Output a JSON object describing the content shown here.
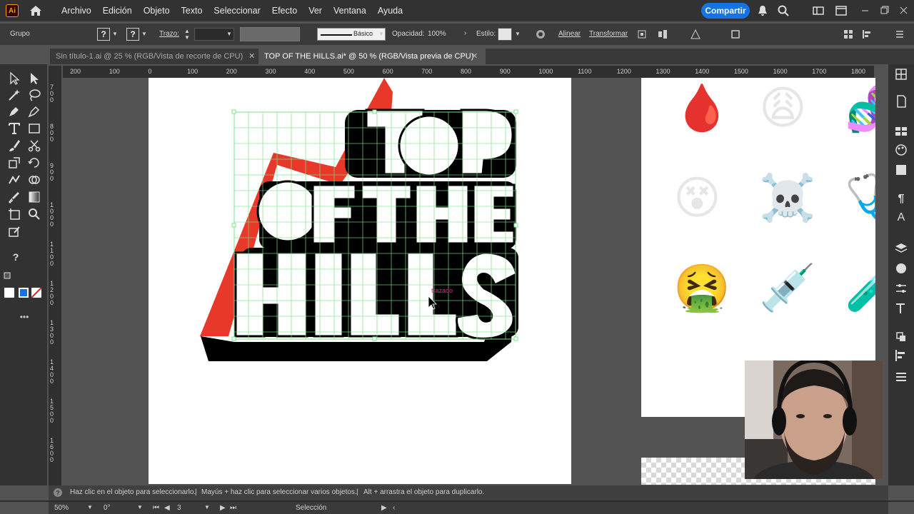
{
  "app": {
    "logo": "Ai"
  },
  "menu": [
    "Archivo",
    "Edición",
    "Objeto",
    "Texto",
    "Seleccionar",
    "Efecto",
    "Ver",
    "Ventana",
    "Ayuda"
  ],
  "share_label": "Compartir",
  "control_bar": {
    "selection_label": "Grupo",
    "stroke_label": "Trazo:",
    "stroke_profile": "Básico",
    "opacity_label": "Opacidad:",
    "opacity_value": "100%",
    "style_label": "Estilo:",
    "align_label": "Alinear",
    "transform_label": "Transformar"
  },
  "tabs": [
    {
      "label": "Sin título-1.ai @ 25 % (RGB/Vista de recorte de CPU)",
      "active": false
    },
    {
      "label": "TOP OF THE HILLS.ai* @ 50 % (RGB/Vista previa de CPU)",
      "active": true
    }
  ],
  "ruler": {
    "h_ticks": [
      "200",
      "100",
      "0",
      "100",
      "200",
      "300",
      "400",
      "500",
      "600",
      "700",
      "800",
      "900",
      "1000",
      "1100",
      "1200",
      "1300",
      "1400",
      "1500",
      "1600",
      "1700",
      "1800"
    ],
    "v_ticks": [
      "7\n0\n0",
      "8\n0\n0",
      "9\n0\n0",
      "1\n0\n0\n0",
      "1\n1\n0\n0",
      "1\n2\n0\n0",
      "1\n3\n0\n0",
      "1\n4\n0\n0",
      "1\n5\n0\n0",
      "1\n6\n0\n0"
    ]
  },
  "artwork": {
    "lines": [
      "TOP",
      "OF THE",
      "HILLS"
    ],
    "hover_label": "trazado"
  },
  "emojis": [
    "🩸",
    "😩",
    "🧬",
    "😵",
    "☠️",
    "🩺",
    "🤮",
    "💉",
    "🧪"
  ],
  "hint": {
    "part1": "Haz clic en el objeto para seleccionarlo.",
    "part2": "Mayús + haz clic para seleccionar varios objetos.",
    "part3": "Alt + arrastra el objeto para duplicarlo."
  },
  "status": {
    "zoom": "50%",
    "rotation": "0°",
    "artboard_num": "3",
    "tool": "Selección"
  },
  "colors": {
    "accent": "#1473e6",
    "red": "#e8382a",
    "green_grid": "#7be38a"
  }
}
